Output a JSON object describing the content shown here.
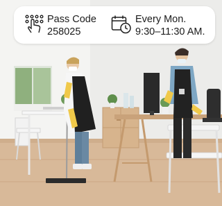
{
  "info_bar": {
    "pass_code": {
      "icon": "keypad-touch-icon",
      "label": "Pass Code",
      "value": "258025"
    },
    "schedule": {
      "icon": "calendar-clock-icon",
      "day": "Every Mon.",
      "time": "9:30–11:30 AM."
    }
  },
  "photo": {
    "subject": "cleaning-staff-photo"
  },
  "colors": {
    "icon_stroke": "#1f1f1f",
    "bar_background": "#ffffff",
    "text": "#1b1b1b"
  }
}
